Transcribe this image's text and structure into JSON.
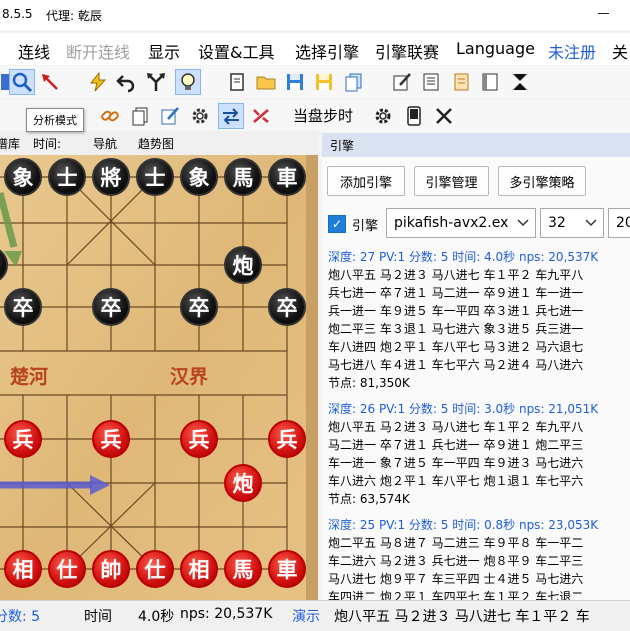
{
  "title": {
    "version": "8.5.5",
    "proxy": "代理: 乾辰"
  },
  "menu": {
    "items": [
      "连线",
      "断开连线",
      "显示",
      "设置&工具",
      "选择引擎",
      "引擎联赛",
      "Language",
      "未注册",
      "关"
    ],
    "disabled_color": "#a0a0a0",
    "unregistered_color": "#1f5ed8"
  },
  "toolbar": {
    "step_label": "当盘步时"
  },
  "tooltip": "分析模式",
  "left_tabs": [
    "谱库",
    "时间:",
    "导航",
    "趋势图"
  ],
  "board": {
    "river_left": "楚河",
    "river_right": "汉界",
    "black_back_rank": [
      "象",
      "士",
      "將",
      "士",
      "象",
      "馬",
      "車"
    ],
    "black_cannon": "炮",
    "black_soldiers": [
      "卒",
      "卒",
      "卒",
      "卒"
    ],
    "red_soldiers": [
      "兵",
      "兵",
      "兵",
      "兵"
    ],
    "red_cannon": "炮",
    "red_back_rank": [
      "相",
      "仕",
      "帥",
      "仕",
      "相",
      "馬",
      "車"
    ]
  },
  "engine_panel": {
    "header": "引擎",
    "buttons": [
      "添加引擎",
      "引擎管理",
      "多引擎策略"
    ],
    "engine_label": "引擎",
    "engine_name": "pikafish-avx2.ex",
    "threads": "32",
    "hash_partial": "20",
    "results": [
      {
        "info": "深度: 27  PV:1  分数: 5  时间:  4.0秒  nps: 20,537K",
        "lines": [
          "炮八平五  马２进３  马八进七  车１平２  车九平八",
          "兵七进一  卒７进１  马二进一  卒９进１  车一进一",
          "兵一进一  车９进５  车一平四  卒３进１  兵七进一",
          "炮二平三  车３退１  马七进六  象３进５  兵三进一",
          "车八进四  炮２平１  车八平七  马３进２  马六退七",
          "马七进八  车４进１  车七平六  马２进４  马八进六"
        ],
        "nodes": "节点: 81,350K"
      },
      {
        "info": "深度: 26  PV:1  分数: 5  时间:  3.0秒  nps: 21,051K",
        "lines": [
          "炮八平五  马２进３  马八进七  车１平２  车九平八",
          "马二进一  卒７进１  兵七进一  卒９进１  炮二平三",
          "车一进一  象７进５  车一平四  车９进３  马七进六",
          "车八进六  炮２平１  车八平七  炮１退１  车七平六"
        ],
        "nodes": "节点: 63,574K"
      },
      {
        "info": "深度: 25  PV:1  分数: 5  时间:  0.8秒  nps: 23,053K",
        "lines": [
          "炮二平五  马８进７  马二进三  车９平８  车一平二",
          "车二进六  马２进３  兵七进一  炮８平９  车二平三",
          "马八进七  炮９平７  车三平四  士４进５  马七进六",
          "车四进二  炮２平１  车四平七  车１平２  车七退二"
        ]
      }
    ]
  },
  "status_bar": {
    "score": "分数: 5",
    "time_label": "时间",
    "time_value": "4.0秒",
    "nps": "nps: 20,537K",
    "demo_label": "演示",
    "line": "炮八平五  马２进３  马八进七  车１平２  车"
  }
}
